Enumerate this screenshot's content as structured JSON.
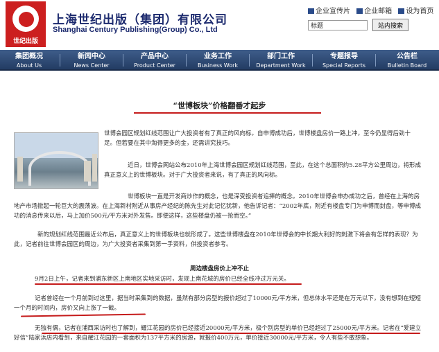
{
  "header": {
    "logo_text": "世纪出版",
    "company_cn": "上海世纪出版（集团）有限公司",
    "company_en": "Shanghai Century Publishing(Group) Co., Ltd",
    "links": [
      "企业宣传片",
      "企业邮箱",
      "设为首页"
    ],
    "search_value": "标题",
    "search_button": "站内搜索"
  },
  "nav": [
    {
      "cn": "集团概况",
      "en": "About Us"
    },
    {
      "cn": "新闻中心",
      "en": "News Center"
    },
    {
      "cn": "产品中心",
      "en": "Product Center"
    },
    {
      "cn": "业务工作",
      "en": "Business Work"
    },
    {
      "cn": "部门工作",
      "en": "Department Work"
    },
    {
      "cn": "专题报导",
      "en": "Special Reports"
    },
    {
      "cn": "公告栏",
      "en": "Bulletin Board"
    }
  ],
  "article": {
    "title": "“世博板块”价格翻番才起步",
    "p1": "世博会园区规划红线范围让广大投资者有了真正的风向标。自申博成功后，世博楼盘房价一路上冲，至今仍显得后劲十足。但若要在其中淘得更多的金，还需讲究技巧。",
    "p2": "近日，世博会网站公布2010年上海世博会园区规划红线范围，至此，在这个总面积约5.28平方公里周边，将形成真正意义上的世博板块。对于广大投资者来说，有了真正的风向标。",
    "p3": "世博板块一直是开发商炒作的概念，也是深受投资者追捧的概念。2010年世博会申办成功之后，曾经在上海的房地产市场掀起一轮巨大的震荡波。在上海新村附近从事房产经纪的陈先生对此记忆犹新，他告诉记者：“2002年底，附近有楼盘专门为申博而封盘，等申博成功的消息传来以后，马上加价500元/平方米对外发售。即便这样，这些楼盘仍被一抢而空。”",
    "p4": "新的规划红线范围最近公布后，真正意义上的世博板块也就形成了。这些世博楼盘在2010年世博会的中长期大利好的刺激下将会有怎样的表现？为此，记者前往世博会园区的周边，为广大投资者采集到第一手资料，供投资者参考。",
    "subheading": "周边楼盘房价上冲不止",
    "p5": "9月2日上午，记者来到浦东新区上南地区实地采访时，发现上南花城的房价已经全线冲过万元关。",
    "p6": "记者曾经在一个月前到过这里，据当时采集到的数据，虽然有部分房型的报价超过了10000元/平方米，但总体水平还是在万元以下，没有想到在短短一个月的时间内，房价又向上涨了一截。",
    "p7": "无独有偶，记者在浦西采访时也了解到，耀江花园的房价已经接近20000元/平方米，极个别房型的单价已经超过了25000元/平方米。记者在“爱建立好信”陆家浜店内看到，来自耀江花园的一套面积为137平方米的房源，就报价400万元，单价接近30000元/平方米，令人有些不敢想象。"
  }
}
